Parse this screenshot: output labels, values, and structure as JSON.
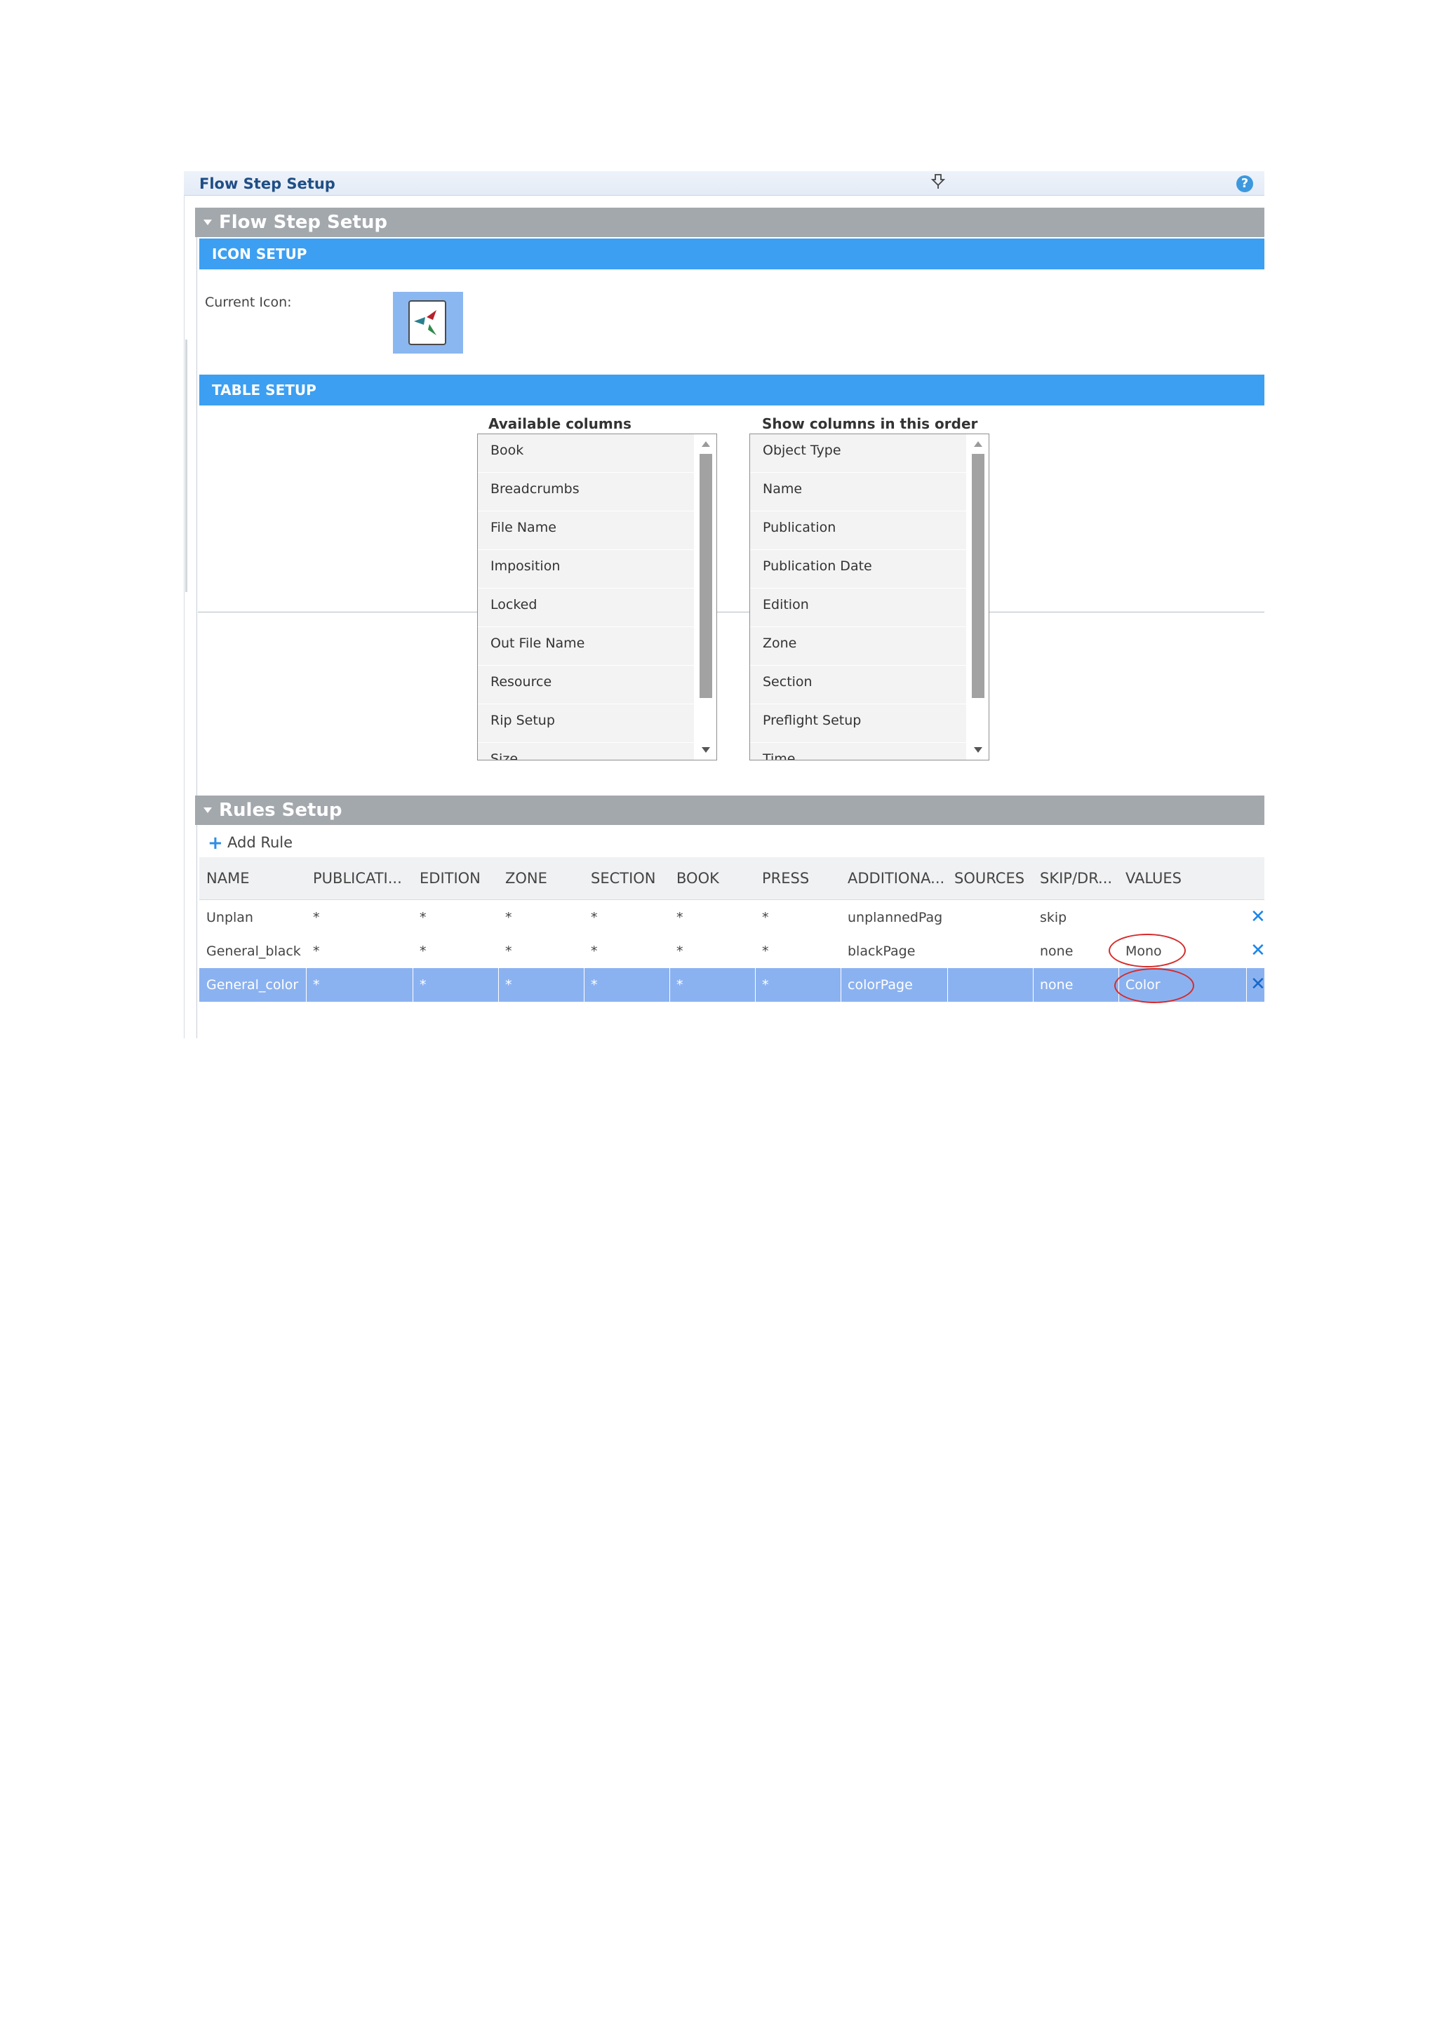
{
  "window": {
    "title": "Flow Step Setup",
    "help_glyph": "?"
  },
  "flow_step_section": {
    "title": "Flow Step Setup"
  },
  "icon_setup": {
    "band_title": "ICON SETUP",
    "current_icon_label": "Current Icon:"
  },
  "table_setup": {
    "band_title": "TABLE SETUP",
    "available_title": "Available columns",
    "available_items": [
      "Book",
      "Breadcrumbs",
      "File Name",
      "Imposition",
      "Locked",
      "Out File Name",
      "Resource",
      "Rip Setup",
      "Size"
    ],
    "order_title": "Show columns in this order",
    "order_items": [
      "Object Type",
      "Name",
      "Publication",
      "Publication Date",
      "Edition",
      "Zone",
      "Section",
      "Preflight Setup",
      "Time"
    ]
  },
  "rules_setup": {
    "title": "Rules Setup",
    "add_rule_label": "Add Rule",
    "columns": [
      "NAME",
      "PUBLICATI...",
      "EDITION",
      "ZONE",
      "SECTION",
      "BOOK",
      "PRESS",
      "ADDITIONA...",
      "SOURCES",
      "SKIP/DR...",
      "VALUES"
    ],
    "rows": [
      {
        "name": "Unplan",
        "publication": "*",
        "edition": "*",
        "zone": "*",
        "section": "*",
        "book": "*",
        "press": "*",
        "additional": "unplannedPag",
        "sources": "",
        "skip": "skip",
        "values": ""
      },
      {
        "name": "General_black",
        "publication": "*",
        "edition": "*",
        "zone": "*",
        "section": "*",
        "book": "*",
        "press": "*",
        "additional": "blackPage",
        "sources": "",
        "skip": "none",
        "values": "Mono"
      },
      {
        "name": "General_color",
        "publication": "*",
        "edition": "*",
        "zone": "*",
        "section": "*",
        "book": "*",
        "press": "*",
        "additional": "colorPage",
        "sources": "",
        "skip": "none",
        "values": "Color",
        "selected": true
      }
    ],
    "delete_glyph": "✕"
  },
  "colors": {
    "band_blue": "#3c9ff2",
    "section_gray": "#a3a8ad",
    "selected_row": "#8bb2f0",
    "annotation_red": "#d62b2b",
    "delete_blue": "#1a86e6"
  },
  "icons": [
    "pin-icon",
    "help-icon",
    "collapse-triangle-icon",
    "flow-step-icon",
    "scroll-up-icon",
    "scroll-down-icon",
    "plus-icon",
    "delete-icon"
  ]
}
